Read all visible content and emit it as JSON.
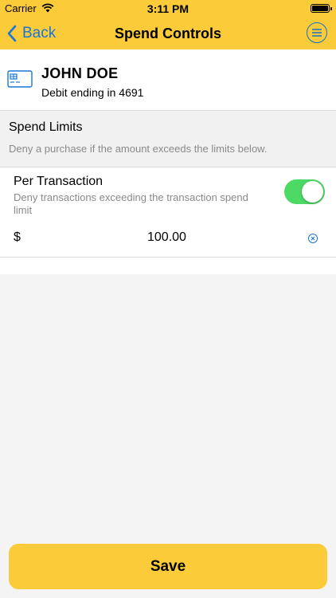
{
  "status_bar": {
    "carrier": "Carrier",
    "time": "3:11 PM"
  },
  "nav": {
    "back_label": "Back",
    "title": "Spend Controls"
  },
  "card": {
    "name": "JOHN DOE",
    "subtitle": "Debit ending in 4691"
  },
  "spend_limits": {
    "title": "Spend Limits",
    "description": "Deny a purchase if the amount exceeds the limits below."
  },
  "per_transaction": {
    "title": "Per Transaction",
    "description": "Deny transactions exceeding the transaction spend limit",
    "enabled": true,
    "currency_symbol": "$",
    "amount": "100.00"
  },
  "save_label": "Save",
  "colors": {
    "accent": "#fbcb3a",
    "link": "#1876d6",
    "toggle_on": "#4cd964",
    "background": "#f4f4f5"
  }
}
